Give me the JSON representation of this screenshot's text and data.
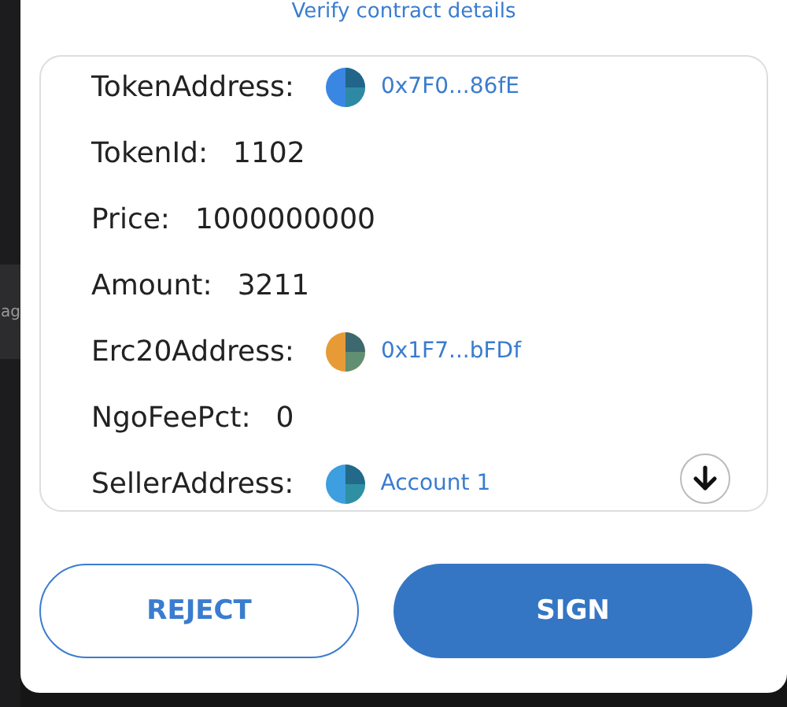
{
  "background_fragment": "ag",
  "verify_link": "Verify contract details",
  "fields": [
    {
      "kind": "address",
      "label": "TokenAddress:",
      "value": "0x7F0...86fE",
      "color": "#3a86e3"
    },
    {
      "kind": "text",
      "label": "TokenId:",
      "value": "1102"
    },
    {
      "kind": "text",
      "label": "Price:",
      "value": "1000000000"
    },
    {
      "kind": "text",
      "label": "Amount:",
      "value": "3211"
    },
    {
      "kind": "address",
      "label": "Erc20Address:",
      "value": "0x1F7...bFDf",
      "color": "#e89a36"
    },
    {
      "kind": "text",
      "label": "NgoFeePct:",
      "value": "0"
    },
    {
      "kind": "address",
      "label": "SellerAddress:",
      "value": "Account 1",
      "color": "#3d9ee0"
    }
  ],
  "buttons": [
    {
      "kind": "secondary",
      "label": "REJECT"
    },
    {
      "kind": "primary",
      "label": "SIGN"
    }
  ]
}
